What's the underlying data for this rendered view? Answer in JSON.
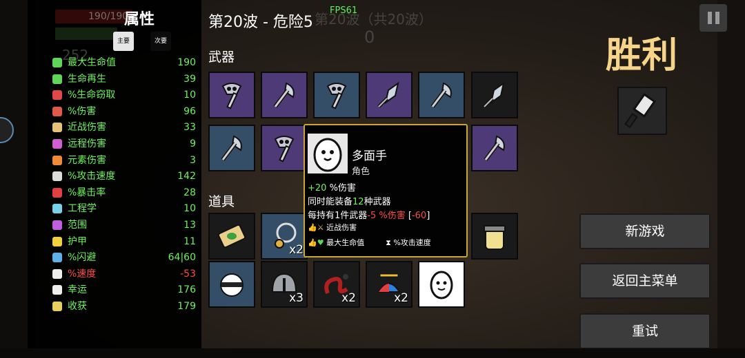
{
  "hud": {
    "hp_text": "190/190",
    "materials_ghost": "252",
    "fps": "FPS61",
    "wave_title": "第20波 - 危险5",
    "ghost_wave": "第20波（共20波）",
    "ghost_timer": "0"
  },
  "stats_panel": {
    "title": "属性",
    "tabs": [
      "主要",
      "次要"
    ],
    "rows": [
      {
        "label": "最大生命值",
        "value": "190",
        "color": "#6ef35a",
        "icon": "heart-icon",
        "icon_color": "#5fd65a"
      },
      {
        "label": "生命再生",
        "value": "39",
        "color": "#6ef35a",
        "icon": "regen-icon",
        "icon_color": "#5fd65a"
      },
      {
        "label": "%生命窃取",
        "value": "10",
        "color": "#6ef35a",
        "icon": "lifesteal-icon",
        "icon_color": "#e0484a"
      },
      {
        "label": "%伤害",
        "value": "96",
        "color": "#6ef35a",
        "icon": "damage-icon",
        "icon_color": "#e05a4a"
      },
      {
        "label": "近战伤害",
        "value": "33",
        "color": "#6ef35a",
        "icon": "melee-icon",
        "icon_color": "#e8c27a"
      },
      {
        "label": "远程伤害",
        "value": "9",
        "color": "#6ef35a",
        "icon": "ranged-icon",
        "icon_color": "#d060d0"
      },
      {
        "label": "元素伤害",
        "value": "3",
        "color": "#6ef35a",
        "icon": "elemental-icon",
        "icon_color": "#f08a3a"
      },
      {
        "label": "%攻击速度",
        "value": "142",
        "color": "#6ef35a",
        "icon": "attack-speed-icon",
        "icon_color": "#dddddd"
      },
      {
        "label": "%暴击率",
        "value": "28",
        "color": "#6ef35a",
        "icon": "crit-icon",
        "icon_color": "#e04040"
      },
      {
        "label": "工程学",
        "value": "10",
        "color": "#6ef35a",
        "icon": "engineering-icon",
        "icon_color": "#7ad0e8"
      },
      {
        "label": "范围",
        "value": "13",
        "color": "#6ef35a",
        "icon": "range-icon",
        "icon_color": "#c060e0"
      },
      {
        "label": "护甲",
        "value": "11",
        "color": "#6ef35a",
        "icon": "armor-icon",
        "icon_color": "#f0d040"
      },
      {
        "label": "%闪避",
        "value": "64|60",
        "color": "#6ef35a",
        "icon": "dodge-icon",
        "icon_color": "#60b0e8"
      },
      {
        "label": "%速度",
        "value": "-53",
        "color": "#ff4a4a",
        "label_color": "#ff4a4a",
        "icon": "speed-icon",
        "icon_color": "#eeeeee"
      },
      {
        "label": "幸运",
        "value": "176",
        "color": "#6ef35a",
        "icon": "luck-icon",
        "icon_color": "#eeeeee"
      },
      {
        "label": "收获",
        "value": "179",
        "color": "#6ef35a",
        "icon": "harvest-icon",
        "icon_color": "#e8d060"
      }
    ]
  },
  "inventory": {
    "weapons_label": "武器",
    "items_label": "道具",
    "weapons": [
      {
        "icon": "skull-axe-icon",
        "rarity": "purple"
      },
      {
        "icon": "axe-icon",
        "rarity": "purple"
      },
      {
        "icon": "skull-axe-icon",
        "rarity": "blue"
      },
      {
        "icon": "spear-icon",
        "rarity": "purple"
      },
      {
        "icon": "axe-icon",
        "rarity": "blue"
      },
      {
        "icon": "spear-icon",
        "rarity": "dark"
      },
      {
        "icon": "axe-icon",
        "rarity": "blue"
      },
      {
        "icon": "skull-axe-icon",
        "rarity": "purple"
      },
      {
        "icon": "axe-icon",
        "rarity": "purple"
      }
    ],
    "items": [
      {
        "icon": "ticket-icon",
        "count": ""
      },
      {
        "icon": "necklace-icon",
        "count": "x2"
      },
      {
        "icon": "jar-icon",
        "count": ""
      },
      {
        "icon": "ninja-icon",
        "count": ""
      },
      {
        "icon": "helmet-icon",
        "count": "x3"
      },
      {
        "icon": "snake-icon",
        "count": "x2"
      },
      {
        "icon": "propeller-hat-icon",
        "count": "x2"
      },
      {
        "icon": "potato-face-icon",
        "count": ""
      }
    ]
  },
  "tooltip": {
    "name": "多面手",
    "subtitle": "角色",
    "line1_value": "+20",
    "line1_text": " %伤害",
    "line2_a": "同时能装备",
    "line2_num": "12",
    "line2_b": "种武器",
    "line3_a": "每持有1件武器",
    "line3_red": "-5 %伤害",
    "line3_b": " [",
    "line3_red2": "-60",
    "line3_c": "]",
    "line4": "近战伤害",
    "line5a": "最大生命值",
    "line5b": "%攻击速度"
  },
  "result": {
    "title": "胜利",
    "buttons": [
      "新游戏",
      "返回主菜单",
      "重试"
    ]
  }
}
